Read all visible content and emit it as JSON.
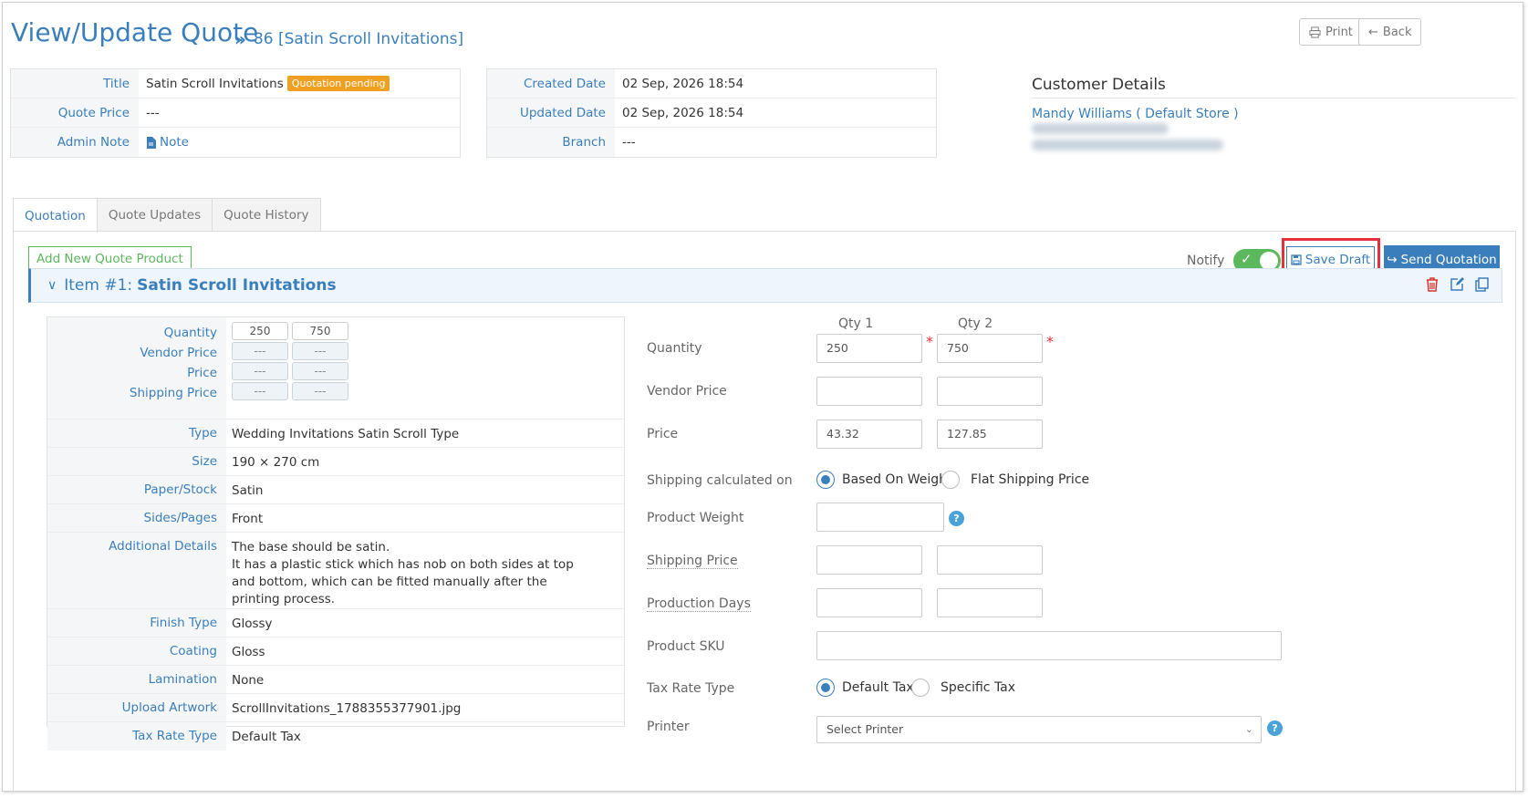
{
  "header": {
    "title": "View/Update Quote",
    "breadcrumb_sep": "»",
    "subtitle": "86 [Satin Scroll Invitations]",
    "print_label": "Print",
    "back_label": "Back"
  },
  "info_left": {
    "rows": [
      {
        "label": "Title",
        "value": "Satin Scroll Invitations",
        "badge": "Quotation pending"
      },
      {
        "label": "Quote Price",
        "value": "---"
      },
      {
        "label": "Admin Note",
        "value": "Note"
      }
    ]
  },
  "info_mid": {
    "rows": [
      {
        "label": "Created Date",
        "value": "02 Sep, 2026 18:54"
      },
      {
        "label": "Updated Date",
        "value": "02 Sep, 2026 18:54"
      },
      {
        "label": "Branch",
        "value": "---"
      }
    ]
  },
  "customer": {
    "heading": "Customer Details",
    "name": "Mandy Williams ( Default Store )"
  },
  "tabs": [
    "Quotation",
    "Quote Updates",
    "Quote History"
  ],
  "toolbar": {
    "add_product": "Add New Quote Product",
    "notify_label": "Notify",
    "save_draft": "Save Draft",
    "send_quotation": "Send Quotation"
  },
  "item": {
    "prefix": "Item #1:",
    "name": "Satin Scroll Invitations"
  },
  "details": {
    "qty_labels": [
      "Quantity",
      "Vendor Price",
      "Price",
      "Shipping Price"
    ],
    "qty_values": [
      [
        "250",
        "750"
      ],
      [
        "---",
        "---"
      ],
      [
        "---",
        "---"
      ],
      [
        "---",
        "---"
      ]
    ],
    "rows": [
      {
        "label": "Type",
        "value": "Wedding Invitations Satin Scroll Type"
      },
      {
        "label": "Size",
        "value": "190 × 270 cm"
      },
      {
        "label": "Paper/Stock",
        "value": "Satin"
      },
      {
        "label": "Sides/Pages",
        "value": "Front"
      },
      {
        "label": "Additional Details",
        "value": "The base should be satin.",
        "value2": "It has a plastic stick which has nob on both sides at top and bottom, which can be fitted manually after the printing process."
      },
      {
        "label": "Finish Type",
        "value": "Glossy"
      },
      {
        "label": "Coating",
        "value": "Gloss"
      },
      {
        "label": "Lamination",
        "value": "None"
      },
      {
        "label": "Upload Artwork",
        "value": "ScrollInvitations_1788355377901.jpg"
      },
      {
        "label": "Tax Rate Type",
        "value": "Default Tax"
      }
    ]
  },
  "form": {
    "qty1_header": "Qty 1",
    "qty2_header": "Qty 2",
    "quantity_label": "Quantity",
    "quantity_1": "250",
    "quantity_2": "750",
    "vendor_price_label": "Vendor Price",
    "price_label": "Price",
    "price_1": "43.32",
    "price_2": "127.85",
    "shipping_calc_label": "Shipping calculated on",
    "shipping_opt_weight": "Based On Weight",
    "shipping_opt_flat": "Flat Shipping Price",
    "product_weight_label": "Product Weight",
    "shipping_price_label": "Shipping Price",
    "production_days_label": "Production Days",
    "product_sku_label": "Product SKU",
    "tax_rate_label": "Tax Rate Type",
    "tax_opt_default": "Default Tax",
    "tax_opt_specific": "Specific Tax",
    "printer_label": "Printer",
    "printer_placeholder": "Select Printer",
    "help_glyph": "?"
  },
  "colors": {
    "accent": "#3a7fbb",
    "success": "#5cb85c",
    "badge": "#f0a020",
    "highlight": "#e5313b"
  }
}
